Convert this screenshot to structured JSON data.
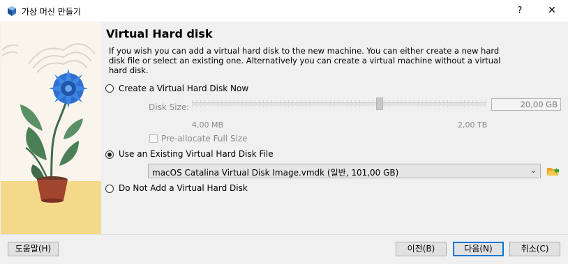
{
  "window": {
    "title": "가상 머신 만들기",
    "help_label": "?",
    "close_label": "✕"
  },
  "page": {
    "heading": "Virtual Hard disk",
    "description": "If you wish you can add a virtual hard disk to the new machine. You can either create a new hard disk file or select an existing one. Alternatively you can create a virtual machine without a virtual hard disk."
  },
  "options": {
    "create_label": "Create a Virtual Hard Disk Now",
    "create_selected": false,
    "disk_size_label": "Disk Size:",
    "disk_size_value": "20,00 GB",
    "slider_min_label": "4,00 MB",
    "slider_max_label": "2,00 TB",
    "preallocate_label": "Pre-allocate Full Size",
    "preallocate_checked": false,
    "existing_label": "Use an Existing Virtual Hard Disk File",
    "existing_selected": true,
    "existing_file": "macOS Catalina Virtual Disk Image.vmdk (일반, 101,00 GB)",
    "none_label": "Do Not Add a Virtual Hard Disk",
    "none_selected": false
  },
  "footer": {
    "help_button": "도움말(H)",
    "back_button": "이전(B)",
    "next_button": "다음(N)",
    "cancel_button": "취소(C)"
  },
  "icons": {
    "app": "virtualbox-icon",
    "folder": "folder-open-icon",
    "combo_arrow": "chevron-down-icon"
  }
}
